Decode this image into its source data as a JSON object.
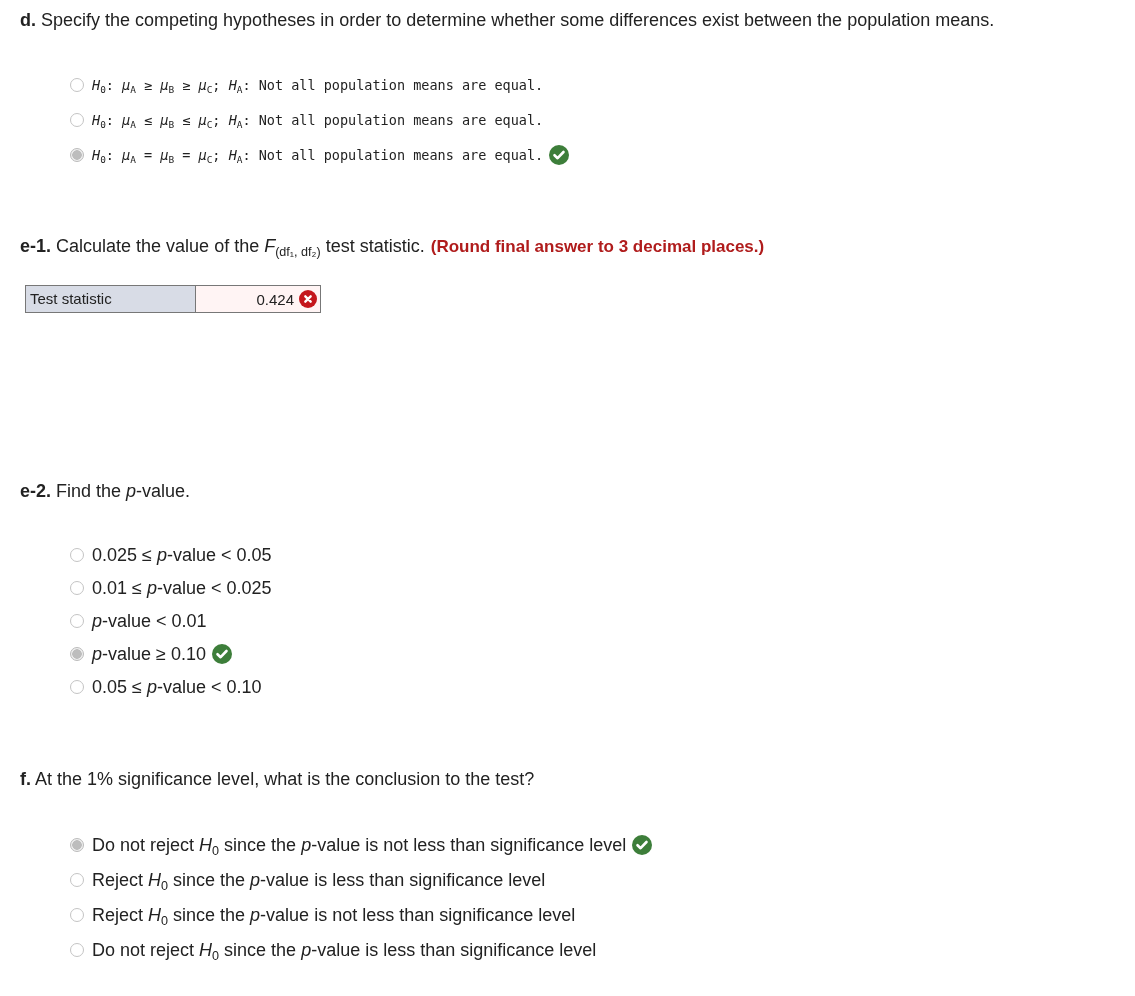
{
  "sections": [
    {
      "kind": "radio",
      "heading": "**d.** Specify the competing hypotheses in order to determine whether some differences exist between the population means.",
      "mono": true,
      "options": [
        {
          "label": "*H*$_{0}$: *μ*$_{A}$ ≥ *μ*$_{B}$ ≥ *μ*$_{C}$; *H*$_{A}$: Not all population means are equal.",
          "selected": false,
          "graded": false
        },
        {
          "label": "*H*$_{0}$: *μ*$_{A}$ ≤ *μ*$_{B}$ ≤ *μ*$_{C}$; *H*$_{A}$: Not all population means are equal.",
          "selected": false,
          "graded": false
        },
        {
          "label": "*H*$_{0}$: *μ*$_{A}$ = *μ*$_{B}$ = *μ*$_{C}$; *H*$_{A}$: Not all population means are equal.",
          "selected": true,
          "graded": true,
          "correct": true
        }
      ]
    },
    {
      "kind": "input",
      "heading": "**e-1.** Calculate the value of the *F*$_{(df₁, df₂)}$ test statistic.",
      "note": "(Round final answer to 3 decimal places.)",
      "field": {
        "label": "Test statistic",
        "value": "0.424",
        "graded": true,
        "correct": false
      }
    },
    {
      "kind": "radio",
      "heading": "**e-2.** Find the *p*-value.",
      "mono": false,
      "options": [
        {
          "label": "0.025 ≤ *p*-value < 0.05",
          "selected": false,
          "graded": false
        },
        {
          "label": "0.01 ≤ *p*-value < 0.025",
          "selected": false,
          "graded": false
        },
        {
          "label": "*p*-value < 0.01",
          "selected": false,
          "graded": false
        },
        {
          "label": "*p*-value ≥ 0.10",
          "selected": true,
          "graded": true,
          "correct": true
        },
        {
          "label": "0.05 ≤ *p*-value < 0.10",
          "selected": false,
          "graded": false
        }
      ]
    },
    {
      "kind": "radio",
      "heading": "**f.** At the 1% significance level, what is the conclusion to the test?",
      "mono": false,
      "options": [
        {
          "label": "Do not reject *H*$_{0}$ since the *p*-value is not less than significance level",
          "selected": true,
          "graded": true,
          "correct": true
        },
        {
          "label": "Reject *H*$_{0}$ since the *p*-value is less than significance level",
          "selected": false,
          "graded": false
        },
        {
          "label": "Reject *H*$_{0}$ since the *p*-value is not less than significance level",
          "selected": false,
          "graded": false
        },
        {
          "label": "Do not reject *H*$_{0}$ since the *p*-value is less than significance level",
          "selected": false,
          "graded": false
        }
      ]
    }
  ]
}
